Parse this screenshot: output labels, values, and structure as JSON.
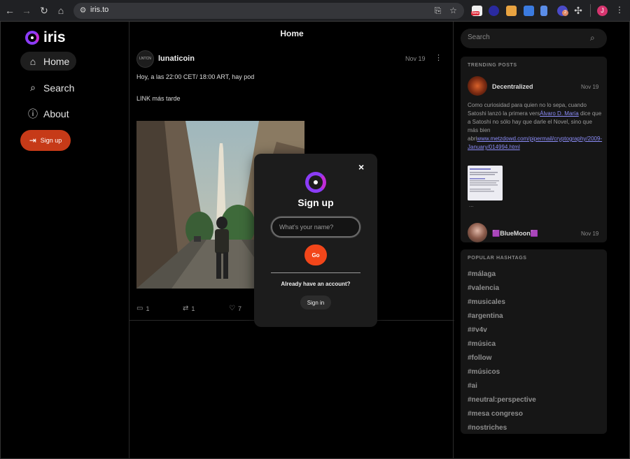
{
  "browser": {
    "url": "iris.to",
    "profile_initial": "J",
    "ext_badge_new": "New",
    "ext_badge_count": "2"
  },
  "sidebar": {
    "logo_text": "iris",
    "items": [
      {
        "label": "Home",
        "icon": "home-icon"
      },
      {
        "label": "Search",
        "icon": "search-icon"
      },
      {
        "label": "About",
        "icon": "info-icon"
      }
    ],
    "signup_label": "Sign up"
  },
  "feed": {
    "title": "Home",
    "post": {
      "avatar_text": "LNTCN",
      "author": "lunaticoin",
      "date": "Nov 19",
      "line1": "Hoy, a las 22:00 CET/ 18:00 ART, hay pod",
      "line2": "LINK más tarde",
      "replies": "1",
      "reposts": "1",
      "likes": "7"
    }
  },
  "right": {
    "search_placeholder": "Search",
    "trending": {
      "title": "TRENDING POSTS",
      "post1": {
        "author": "Decentralized",
        "date": "Nov 19",
        "text1": "Como curiosidad para quien no lo sepa, cuando Satoshi lanzó la primera vers",
        "mention": "Álvaro D. María",
        "text2": " dice que a Satoshi no sólo hay que darle el Novel, sino que más bien abri",
        "link": "www.metzdowd.com/pipermail/cryptography/2009-January/014994.html",
        "ellipsis": "..."
      },
      "post2": {
        "author": "🟪BlueMoon🟪",
        "date": "Nov 19"
      }
    },
    "hashtags": {
      "title": "POPULAR HASHTAGS",
      "items": [
        "#málaga",
        "#valencia",
        "#musicales",
        "#argentina",
        "##v4v",
        "#música",
        "#follow",
        "#músicos",
        "#ai",
        "#neutral:perspective",
        "#mesa congreso",
        "#nostriches"
      ]
    }
  },
  "modal": {
    "title": "Sign up",
    "name_placeholder": "What's your name?",
    "go_label": "Go",
    "have_account": "Already have an account?",
    "signin_label": "Sign in",
    "close": "×"
  },
  "colors": {
    "accent": "#8b3cf7",
    "signup": "#c63a18",
    "go": "#f2461a"
  }
}
